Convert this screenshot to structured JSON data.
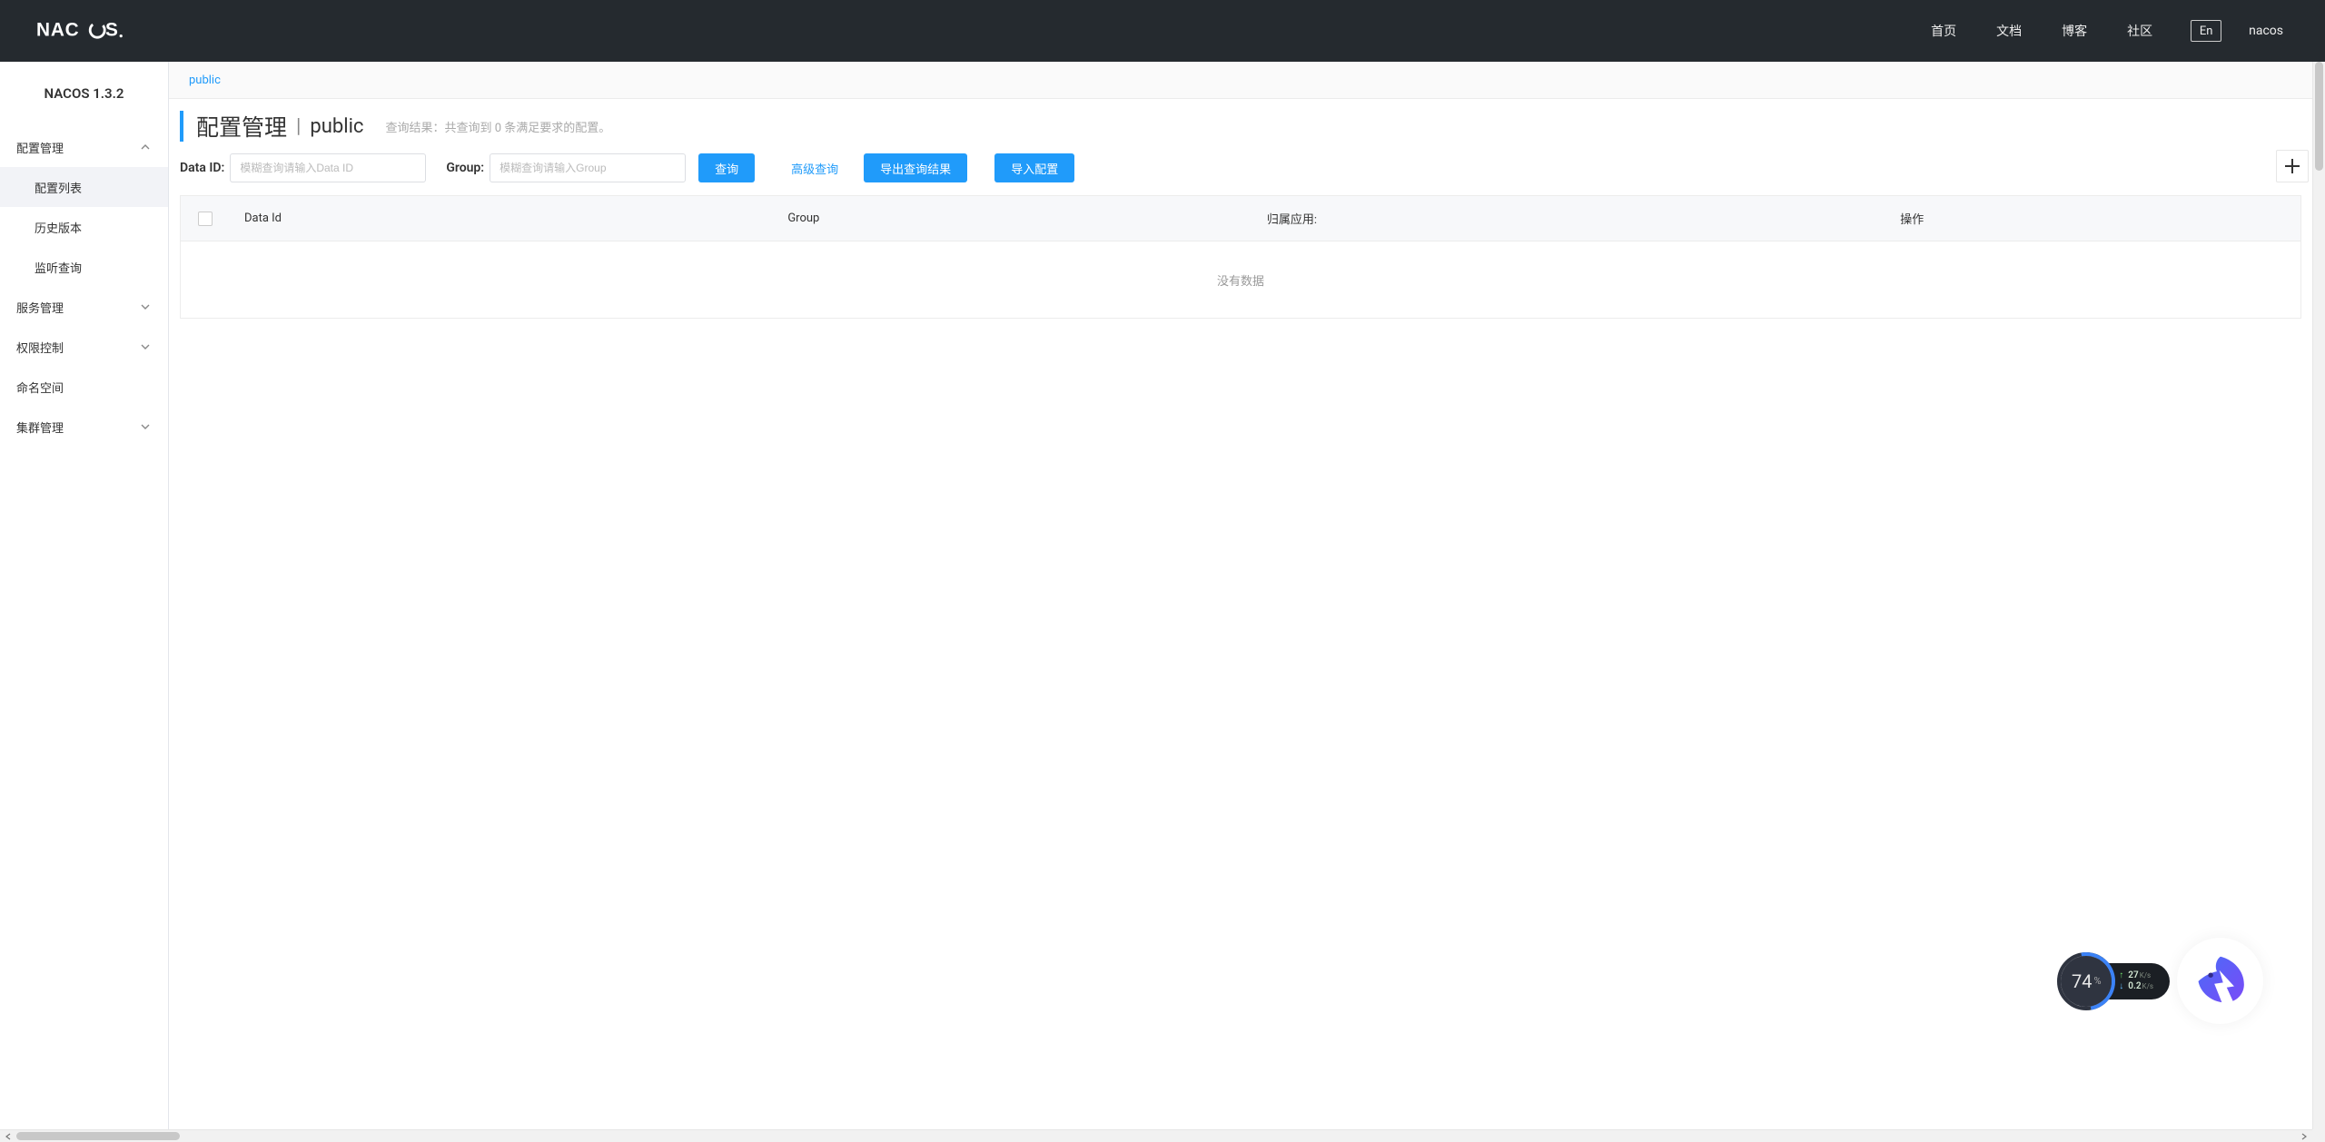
{
  "header": {
    "brand": "NACOS.",
    "nav": [
      "首页",
      "文档",
      "博客",
      "社区"
    ],
    "lang": "En",
    "user": "nacos"
  },
  "sidebar": {
    "title": "NACOS 1.3.2",
    "menus": [
      {
        "label": "配置管理",
        "expanded": true,
        "children": [
          "配置列表",
          "历史版本",
          "监听查询"
        ],
        "activeChild": 0
      },
      {
        "label": "服务管理",
        "expanded": false
      },
      {
        "label": "权限控制",
        "expanded": false
      },
      {
        "label": "命名空间",
        "noArrow": true
      },
      {
        "label": "集群管理",
        "expanded": false
      }
    ]
  },
  "namespaceTab": "public",
  "page": {
    "title": "配置管理",
    "namespace": "public",
    "resultLabel": "查询结果：",
    "resultText": "共查询到 0 条满足要求的配置。"
  },
  "search": {
    "dataIdLabel": "Data ID:",
    "dataIdPlaceholder": "模糊查询请输入Data ID",
    "groupLabel": "Group:",
    "groupPlaceholder": "模糊查询请输入Group",
    "queryBtn": "查询",
    "advanced": "高级查询",
    "exportBtn": "导出查询结果",
    "importBtn": "导入配置"
  },
  "table": {
    "columns": {
      "dataId": "Data Id",
      "group": "Group",
      "app": "归属应用:",
      "op": "操作"
    },
    "empty": "没有数据"
  },
  "widget": {
    "cpu": "74",
    "pct": "%",
    "up": "27",
    "upUnit": "K/s",
    "down": "0.2",
    "downUnit": "K/s"
  }
}
